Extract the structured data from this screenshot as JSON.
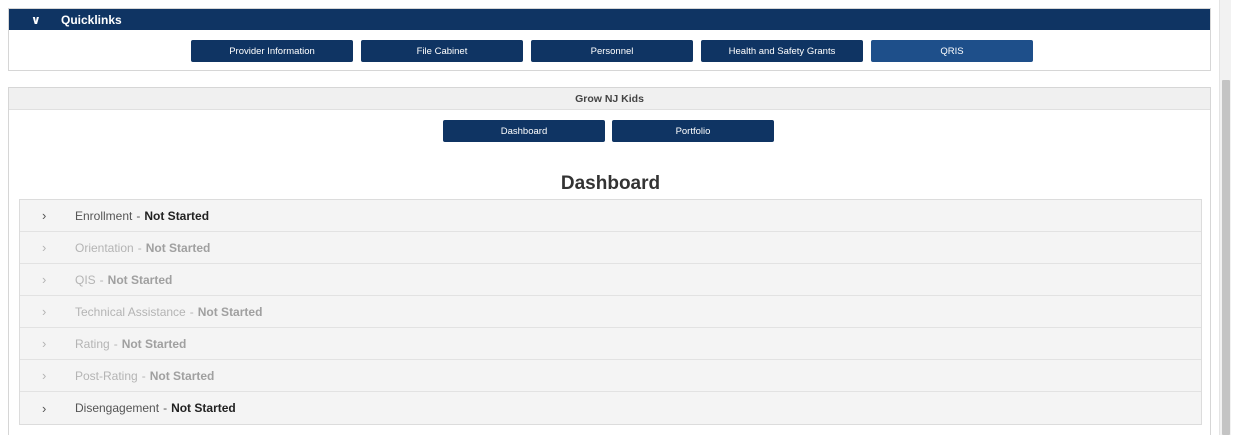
{
  "quicklinks": {
    "title": "Quicklinks",
    "buttons": [
      {
        "label": "Provider Information"
      },
      {
        "label": "File Cabinet"
      },
      {
        "label": "Personnel"
      },
      {
        "label": "Health and Safety Grants"
      },
      {
        "label": "QRIS"
      }
    ]
  },
  "grow_panel": {
    "title": "Grow NJ Kids",
    "buttons": [
      {
        "label": "Dashboard"
      },
      {
        "label": "Portfolio"
      }
    ]
  },
  "dashboard": {
    "title": "Dashboard",
    "separator": "-",
    "stages": [
      {
        "name": "Enrollment",
        "status": "Not Started"
      },
      {
        "name": "Orientation",
        "status": "Not Started"
      },
      {
        "name": "QIS",
        "status": "Not Started"
      },
      {
        "name": "Technical Assistance",
        "status": "Not Started"
      },
      {
        "name": "Rating",
        "status": "Not Started"
      },
      {
        "name": "Post-Rating",
        "status": "Not Started"
      },
      {
        "name": "Disengagement",
        "status": "Not Started"
      }
    ]
  },
  "icons": {
    "collapse": "chevron-down-icon",
    "expand": "chevron-right-icon"
  },
  "colors": {
    "primary_navy": "#0f3463",
    "active_button": "#1e4f8a",
    "panel_header_gray": "#f0f0f0",
    "disabled_text": "#b4b4b4"
  }
}
